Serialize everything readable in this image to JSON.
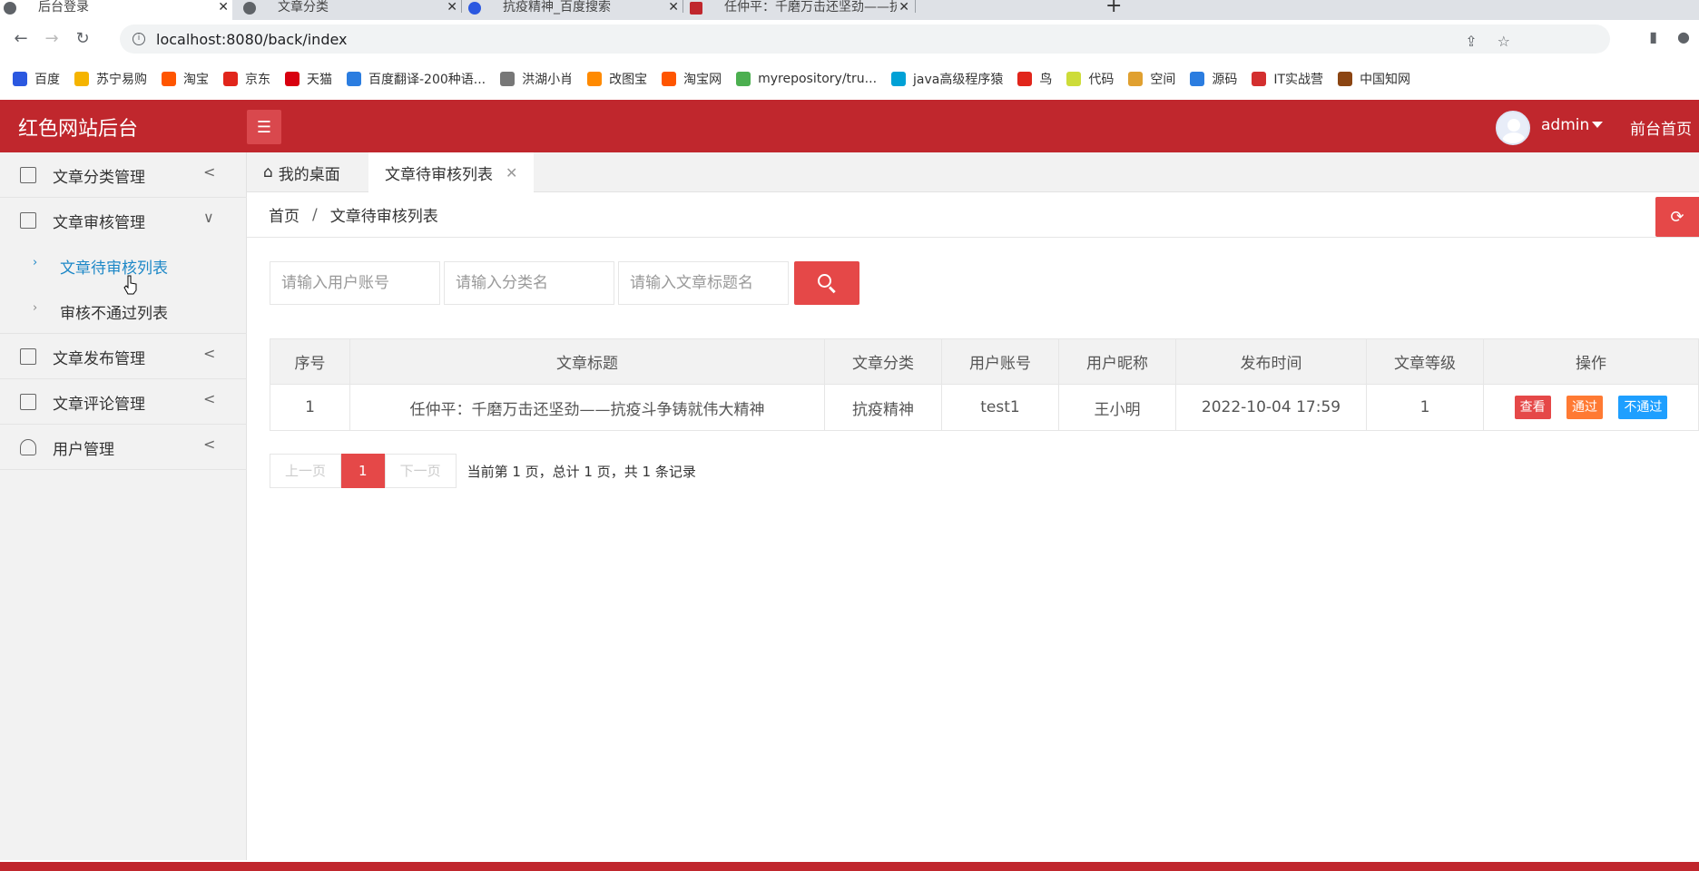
{
  "browser": {
    "tabs": [
      {
        "title": "后台登录"
      },
      {
        "title": "文章分类"
      },
      {
        "title": "抗疫精神_百度搜索"
      },
      {
        "title": "任仲平：千磨万击还坚劲——抗"
      }
    ],
    "url": "localhost:8080/back/index",
    "bookmarks": [
      {
        "label": "百度",
        "color": "#2b58e0"
      },
      {
        "label": "苏宁易购",
        "color": "#f5b400"
      },
      {
        "label": "淘宝",
        "color": "#ff5500"
      },
      {
        "label": "京东",
        "color": "#e1251b"
      },
      {
        "label": "天猫",
        "color": "#d8000f"
      },
      {
        "label": "百度翻译-200种语...",
        "color": "#2b7de0"
      },
      {
        "label": "洪湖小肖",
        "color": "#777777"
      },
      {
        "label": "改图宝",
        "color": "#ff8a00"
      },
      {
        "label": "淘宝网",
        "color": "#ff5500"
      },
      {
        "label": "myrepository/tru...",
        "color": "#4caf50"
      },
      {
        "label": "java高级程序猿",
        "color": "#00a1d6"
      },
      {
        "label": "鸟",
        "color": "#e1251b"
      },
      {
        "label": "代码",
        "color": "#cddc39"
      },
      {
        "label": "空间",
        "color": "#e0a030"
      },
      {
        "label": "源码",
        "color": "#2b7de0"
      },
      {
        "label": "IT实战营",
        "color": "#d32f2f"
      },
      {
        "label": "中国知网",
        "color": "#8b4513"
      }
    ]
  },
  "header": {
    "title": "红色网站后台",
    "username": "admin",
    "front_link": "前台首页"
  },
  "sidebar": {
    "items": [
      {
        "label": "文章分类管理",
        "arrow": "<"
      },
      {
        "label": "文章审核管理",
        "arrow": "∨"
      },
      {
        "label": "文章发布管理",
        "arrow": "<"
      },
      {
        "label": "文章评论管理",
        "arrow": "<"
      },
      {
        "label": "用户管理",
        "arrow": "<"
      }
    ],
    "sub_items": [
      {
        "label": "文章待审核列表"
      },
      {
        "label": "审核不通过列表"
      }
    ]
  },
  "page_tabs": [
    {
      "label": "我的桌面"
    },
    {
      "label": "文章待审核列表"
    }
  ],
  "breadcrumb": {
    "home": "首页",
    "separator": "/",
    "current": "文章待审核列表"
  },
  "search": {
    "user_placeholder": "请输入用户账号",
    "category_placeholder": "请输入分类名",
    "title_placeholder": "请输入文章标题名"
  },
  "table": {
    "headers": [
      "序号",
      "文章标题",
      "文章分类",
      "用户账号",
      "用户昵称",
      "发布时间",
      "文章等级",
      "操作"
    ],
    "rows": [
      {
        "index": "1",
        "title": "任仲平：千磨万击还坚劲——抗疫斗争铸就伟大精神",
        "category": "抗疫精神",
        "account": "test1",
        "nickname": "王小明",
        "time": "2022-10-04 17:59",
        "level": "1",
        "actions": {
          "view": "查看",
          "pass": "通过",
          "reject": "不通过"
        }
      }
    ]
  },
  "pagination": {
    "prev": "上一页",
    "current": "1",
    "next": "下一页",
    "info": "当前第 1 页，总计 1 页，共 1 条记录"
  },
  "colors": {
    "brand": "#c0272d",
    "accent": "#e54848",
    "active_link": "#1e88c7"
  }
}
